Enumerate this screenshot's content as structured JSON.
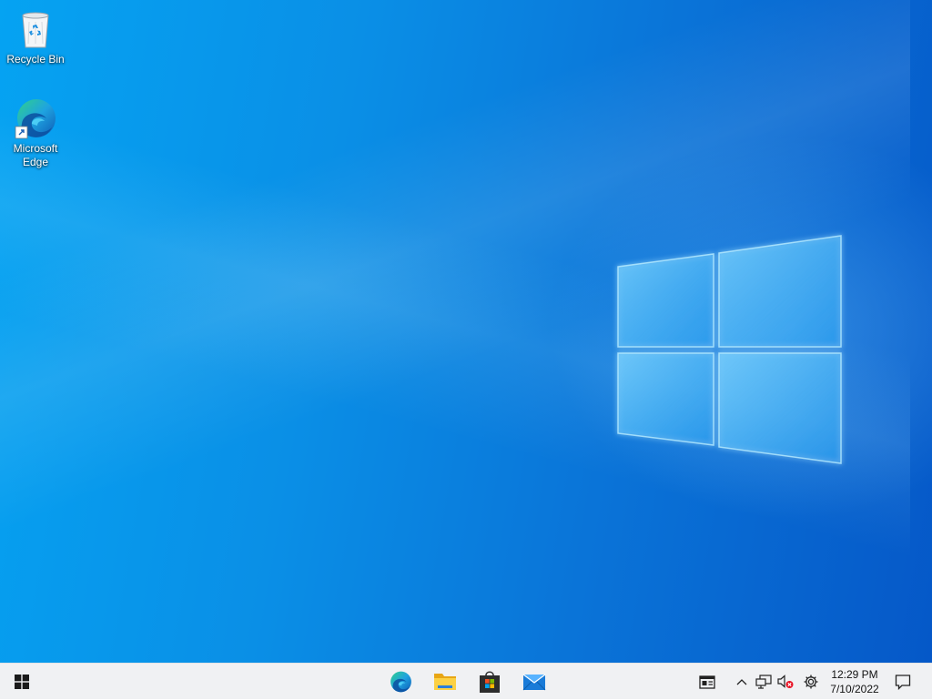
{
  "desktop": {
    "icons": [
      {
        "label": "Recycle Bin",
        "icon": "recycle-bin-icon"
      },
      {
        "label": "Microsoft\nEdge",
        "icon": "edge-icon",
        "shortcut": true
      }
    ]
  },
  "taskbar": {
    "start": {
      "icon": "windows-start-icon"
    },
    "pinned": [
      {
        "icon": "edge-icon"
      },
      {
        "icon": "file-explorer-icon"
      },
      {
        "icon": "microsoft-store-icon"
      },
      {
        "icon": "mail-icon"
      }
    ],
    "tray": {
      "news_icon": "news-widget-icon",
      "icons": [
        "chevron-up-icon",
        "network-icon",
        "volume-muted-icon",
        "settings-gear-icon",
        "notification-icon"
      ],
      "time": "12:29 PM",
      "date": "7/10/2022"
    }
  },
  "colors": {
    "wallpaper_light": "#05a3f2",
    "wallpaper_dark": "#0558c8",
    "taskbar_bg": "#f0f1f3"
  }
}
